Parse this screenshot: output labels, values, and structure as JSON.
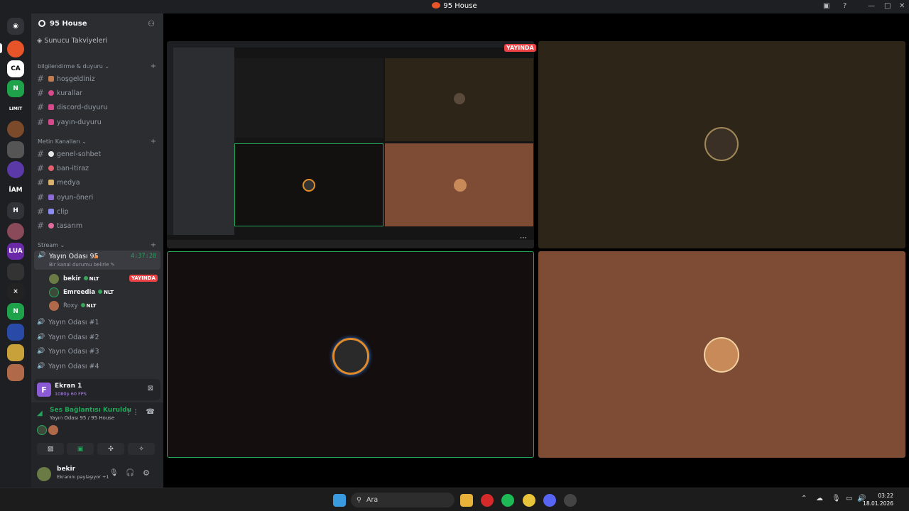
{
  "window": {
    "title": "95 House"
  },
  "server": {
    "name": "95 House",
    "boosts": "Sunucu Takviyeleri"
  },
  "categories": {
    "info": "bilgilendirme & duyuru",
    "text": "Metin Kanalları",
    "stream": "Stream"
  },
  "info_channels": [
    {
      "name": "hoşgeldiniz",
      "color": "#c27c4e"
    },
    {
      "name": "kurallar",
      "color": "#d64a8c"
    },
    {
      "name": "discord-duyuru",
      "color": "#d64a8c"
    },
    {
      "name": "yayın-duyuru",
      "color": "#d64a8c"
    }
  ],
  "text_channels": [
    {
      "name": "genel-sohbet",
      "color": "#e6e6e6"
    },
    {
      "name": "ban-itiraz",
      "color": "#e45f6e"
    },
    {
      "name": "medya",
      "color": "#d9b36b"
    },
    {
      "name": "oyun-öneri",
      "color": "#8c6bd9"
    },
    {
      "name": "clip",
      "color": "#8c8cf0"
    },
    {
      "name": "tasarım",
      "color": "#e06c9e"
    }
  ],
  "active_voice": {
    "name": "Yayın Odası 95",
    "timer": "4:37:28",
    "status": "Bir kanal durumu belirle"
  },
  "members": [
    {
      "name": "bekir",
      "tag": "NLT",
      "live": "YAYINDA",
      "color": "#6b7b45"
    },
    {
      "name": "Emreedia",
      "tag": "NLT",
      "color": "#3d4a3a"
    },
    {
      "name": "Roxy",
      "tag": "NLT",
      "color": "#b06a4a"
    }
  ],
  "voice_channels": [
    "Yayın Odası #1",
    "Yayın Odası #2",
    "Yayın Odası #3",
    "Yayın Odası #4"
  ],
  "screen_share": {
    "title": "Ekran 1",
    "quality": "1080p 60 FPS"
  },
  "voice_connection": {
    "status": "Ses Bağlantısı Kuruldu",
    "location": "Yayın Odası 95",
    "server": "/ 95 House"
  },
  "user": {
    "name": "bekir",
    "status": "Ekranını paylaşıyor",
    "extra": "+1"
  },
  "stage_live": "YAYINDA",
  "taskbar": {
    "search": "Ara",
    "time": "03:22",
    "date": "18.01.2026"
  },
  "colors": {
    "accent_green": "#23a55a",
    "live_red": "#ed4245",
    "tile_dark": "#2e2519",
    "tile_orange": "#7e4b35",
    "tile_black": "#140e0e"
  }
}
